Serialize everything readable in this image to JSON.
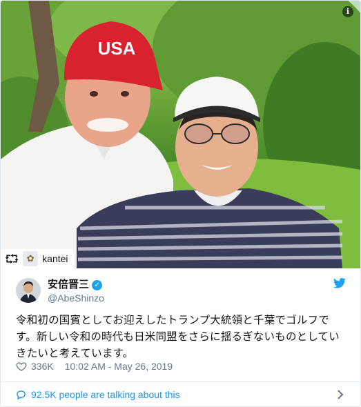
{
  "photo": {
    "info_icon": "info-icon",
    "cap_text": "USA",
    "retweet": {
      "icon": "retweet-icon",
      "account": "kantei"
    }
  },
  "author": {
    "display_name": "安倍晋三",
    "handle": "@AbeShinzo",
    "verified": true
  },
  "tweet": {
    "text": "令和初の国賓としてお迎えしたトランプ大統領と千葉でゴルフです。新しい令和の時代も日米同盟をさらに揺るぎないものとしていきたいと考えています。"
  },
  "meta": {
    "likes": "336K",
    "timestamp": "10:02 AM - May 26, 2019"
  },
  "footer": {
    "talking": "92.5K people are talking about this"
  },
  "colors": {
    "brand": "#1da1f2",
    "link": "#1b95e0",
    "muted": "#657786"
  }
}
